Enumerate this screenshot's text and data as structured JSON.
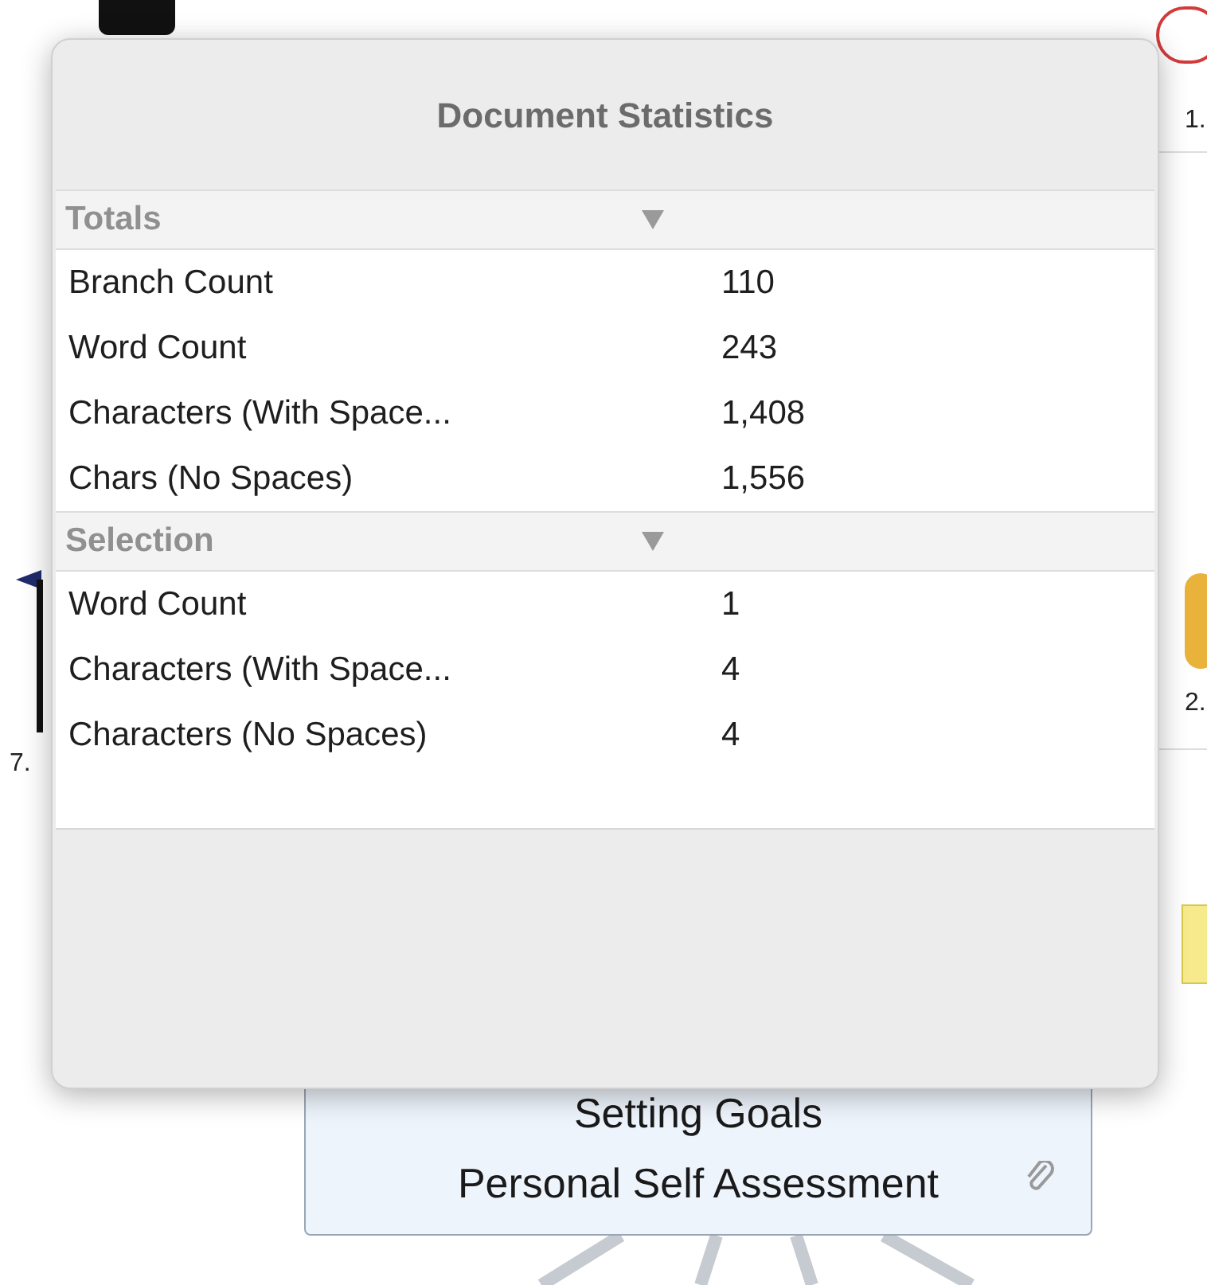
{
  "popover": {
    "title": "Document Statistics",
    "sections": [
      {
        "label": "Totals",
        "expanded": true,
        "rows": [
          {
            "label": "Branch Count",
            "value": "110"
          },
          {
            "label": "Word Count",
            "value": "243"
          },
          {
            "label": "Characters (With Space...",
            "value": "1,408"
          },
          {
            "label": "Chars (No Spaces)",
            "value": "1,556"
          }
        ]
      },
      {
        "label": "Selection",
        "expanded": true,
        "rows": [
          {
            "label": "Word Count",
            "value": "1"
          },
          {
            "label": "Characters (With Space...",
            "value": "4"
          },
          {
            "label": "Characters (No Spaces)",
            "value": "4"
          }
        ]
      }
    ]
  },
  "map": {
    "central_topic": {
      "lines": [
        "Setting Goals",
        "Personal Self Assessment"
      ],
      "attachment": true
    },
    "number_labels": [
      "1.",
      "2.",
      "7."
    ]
  }
}
